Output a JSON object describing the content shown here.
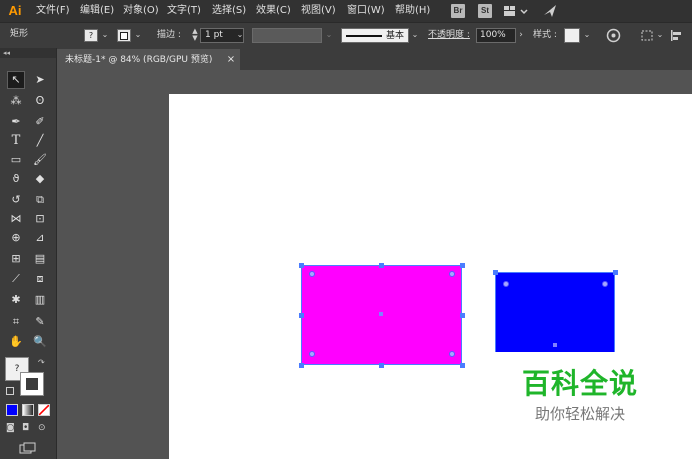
{
  "app": {
    "logo": "Ai"
  },
  "menus": [
    "文件(F)",
    "编辑(E)",
    "对象(O)",
    "文字(T)",
    "选择(S)",
    "效果(C)",
    "视图(V)",
    "窗口(W)",
    "帮助(H)"
  ],
  "bridge_buttons": {
    "br": "Br",
    "st": "St"
  },
  "controlbar": {
    "selection_type": "矩形",
    "fill_box": "?",
    "stroke_label": "描边 :",
    "stroke_weight": "1 pt",
    "brush_label": "基本",
    "opacity_label": "不透明度 :",
    "opacity_value": "100%",
    "style_label": "样式 :"
  },
  "document_tab": {
    "title": "未标题-1* @ 84% (RGB/GPU 预览)",
    "close": "×"
  },
  "toolbar": {
    "fill_stroke_question": "?"
  },
  "icons": {
    "arrange-documents": "arrange-documents-icon",
    "gpu-performance": "rocket-icon",
    "recolor": "color-wheel-icon",
    "transform": "transform-icon",
    "align": "align-icon",
    "edit-toolbar": "more-tools-icon"
  },
  "colors": {
    "magenta_fill": "#ff00ff",
    "blue_fill": "#0000ff",
    "selection": "#4a7cff",
    "app_logo": "#ff9a00",
    "watermark_title": "#1fb52a"
  },
  "watermark": {
    "title": "百科全说",
    "subtitle": "助你轻松解决"
  }
}
